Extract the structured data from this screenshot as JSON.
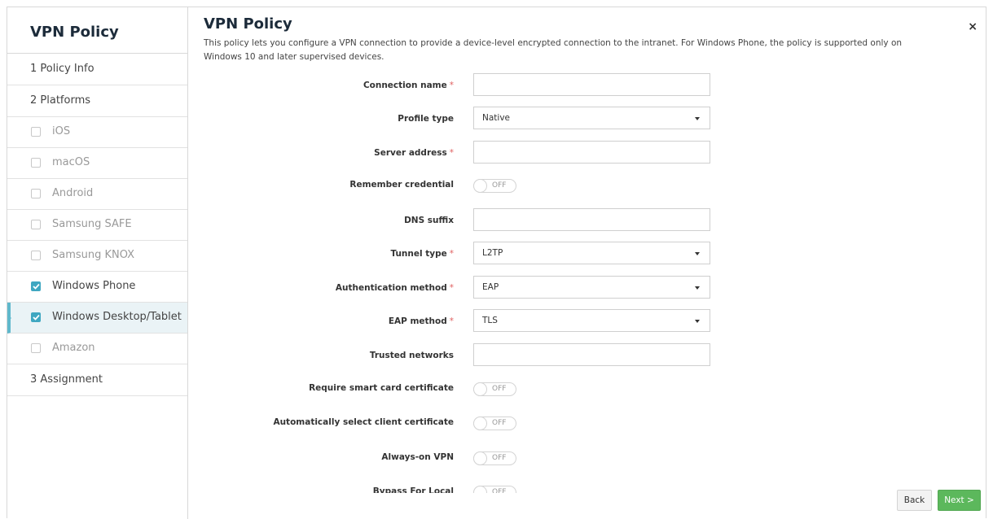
{
  "sidebar": {
    "title": "VPN Policy",
    "steps": [
      {
        "label": "1  Policy Info"
      },
      {
        "label": "2  Platforms"
      }
    ],
    "platforms": [
      {
        "label": "iOS",
        "checked": false
      },
      {
        "label": "macOS",
        "checked": false
      },
      {
        "label": "Android",
        "checked": false
      },
      {
        "label": "Samsung SAFE",
        "checked": false
      },
      {
        "label": "Samsung KNOX",
        "checked": false
      },
      {
        "label": "Windows Phone",
        "checked": true
      },
      {
        "label": "Windows Desktop/Tablet",
        "checked": true,
        "active": true
      },
      {
        "label": "Amazon",
        "checked": false
      }
    ],
    "assignment": "3  Assignment"
  },
  "main": {
    "title": "VPN Policy",
    "description": "This policy lets you configure a VPN connection to provide a device-level encrypted connection to the intranet. For Windows Phone, the policy is supported only on Windows 10 and later supervised devices.",
    "close": "×"
  },
  "form": {
    "connection_name": {
      "label": "Connection name",
      "value": ""
    },
    "profile_type": {
      "label": "Profile type",
      "value": "Native"
    },
    "server_address": {
      "label": "Server address",
      "value": ""
    },
    "remember_credential": {
      "label": "Remember credential",
      "state": "OFF"
    },
    "dns_suffix": {
      "label": "DNS suffix",
      "value": ""
    },
    "tunnel_type": {
      "label": "Tunnel type",
      "value": "L2TP"
    },
    "authentication_method": {
      "label": "Authentication method",
      "value": "EAP"
    },
    "eap_method": {
      "label": "EAP method",
      "value": "TLS"
    },
    "trusted_networks": {
      "label": "Trusted networks",
      "value": ""
    },
    "require_smart_card": {
      "label": "Require smart card certificate",
      "state": "OFF"
    },
    "auto_select_cert": {
      "label": "Automatically select client certificate",
      "state": "OFF"
    },
    "always_on": {
      "label": "Always-on VPN",
      "state": "OFF"
    },
    "bypass_for_local": {
      "label": "Bypass For Local",
      "state": "OFF"
    }
  },
  "footer": {
    "back": "Back",
    "next": "Next >"
  },
  "colors": {
    "accent": "#3fa7c1",
    "next_button": "#5cb85c",
    "required": "#e06060"
  }
}
